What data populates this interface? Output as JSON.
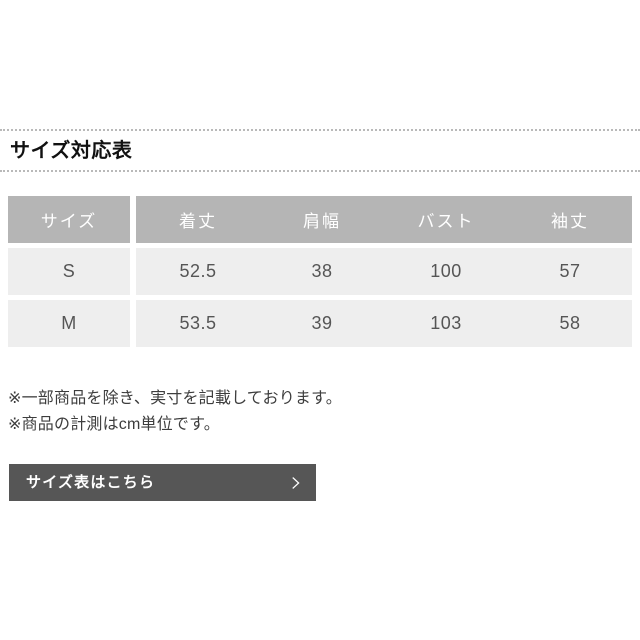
{
  "section": {
    "title": "サイズ対応表"
  },
  "table": {
    "headers": [
      "サイズ",
      "着丈",
      "肩幅",
      "バスト",
      "袖丈"
    ],
    "rows": [
      {
        "size": "S",
        "values": [
          "52.5",
          "38",
          "100",
          "57"
        ]
      },
      {
        "size": "M",
        "values": [
          "53.5",
          "39",
          "103",
          "58"
        ]
      }
    ]
  },
  "notes": [
    "※一部商品を除き、実寸を記載しております。",
    "※商品の計測はcm単位です。"
  ],
  "cta": {
    "label": "サイズ表はこちら",
    "icon": "chevron-right-icon"
  },
  "colors": {
    "header_bg": "#b5b5b5",
    "row_bg": "#eeeeee",
    "cta_bg": "#565656",
    "title_text": "#111111",
    "body_text": "#555555",
    "rule": "#b9b9b9"
  }
}
